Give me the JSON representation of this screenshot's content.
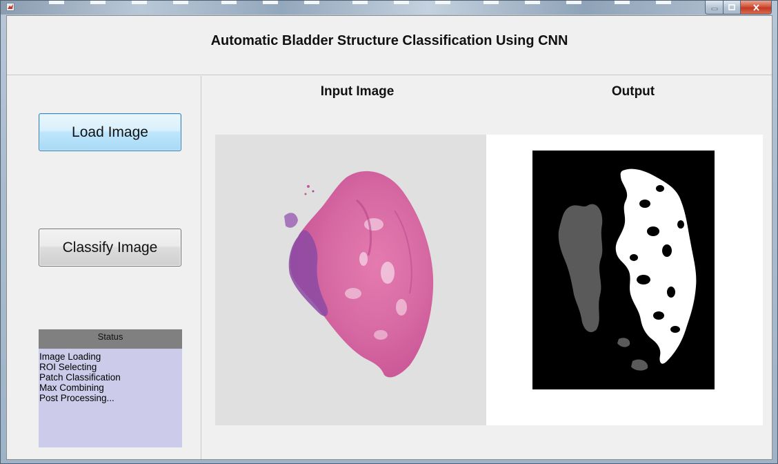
{
  "window": {
    "title_text": "",
    "controls": [
      "minimize-icon",
      "maximize-icon",
      "close-icon"
    ]
  },
  "header": {
    "title": "Automatic Bladder Structure Classification Using CNN"
  },
  "left_panel": {
    "load_button_label": "Load Image",
    "classify_button_label": "Classify Image",
    "status": {
      "heading": "Status",
      "lines": [
        "Image Loading",
        "ROI Selecting",
        "Patch Classification",
        "Max Combining",
        "Post Processing..."
      ]
    }
  },
  "main": {
    "input_label": "Input Image",
    "output_label": "Output"
  },
  "colors": {
    "tissue_pink": "#d9669e",
    "tissue_purple": "#7f4aa0",
    "mask_white": "#ffffff",
    "mask_gray": "#5a5a5a",
    "mask_background": "#000000",
    "status_background": "#ccccea",
    "status_header": "#808080"
  }
}
